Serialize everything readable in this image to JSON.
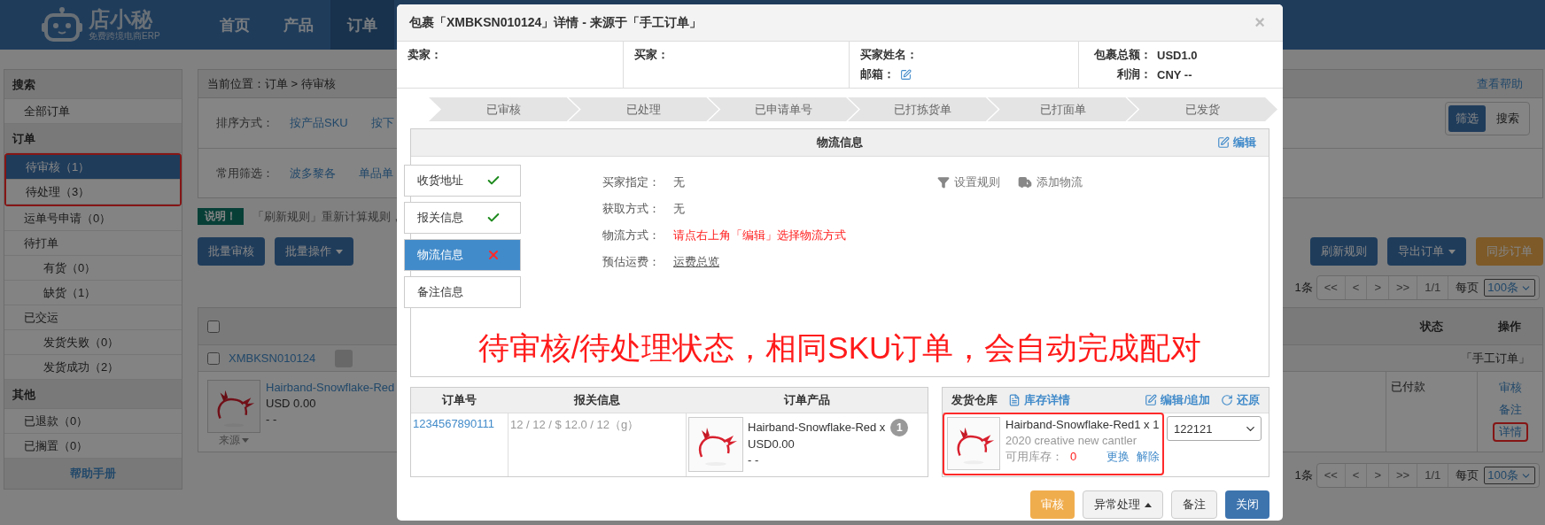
{
  "header": {
    "logo_name": "店小秘",
    "logo_tagline": "免费跨境电商ERP",
    "nav": [
      {
        "label": "首页",
        "selected": false
      },
      {
        "label": "产品",
        "selected": false
      },
      {
        "label": "订单",
        "selected": true
      }
    ]
  },
  "sidebar": {
    "sections": [
      {
        "title": "搜索",
        "items": [
          {
            "label": "全部订单",
            "selected": false,
            "highlighted": false
          }
        ]
      },
      {
        "title": "订单",
        "items": [
          {
            "label": "待审核（1）",
            "selected": true,
            "highlighted": true
          },
          {
            "label": "待处理（3）",
            "selected": false,
            "highlighted": true
          },
          {
            "label": "运单号申请（0）",
            "selected": false,
            "highlighted": false
          },
          {
            "label": "待打单",
            "selected": false,
            "highlighted": false,
            "children": [
              {
                "label": "有货（0）",
                "selected": false
              },
              {
                "label": "缺货（1）",
                "selected": false
              }
            ]
          },
          {
            "label": "已交运",
            "selected": false,
            "highlighted": false,
            "children": [
              {
                "label": "发货失败（0）",
                "selected": false
              },
              {
                "label": "发货成功（2）",
                "selected": false
              }
            ]
          }
        ]
      },
      {
        "title": "其他",
        "items": [
          {
            "label": "已退款（0）",
            "selected": false,
            "highlighted": false
          },
          {
            "label": "已搁置（0）",
            "selected": false,
            "highlighted": false
          }
        ]
      }
    ],
    "help": "帮助手册"
  },
  "main": {
    "breadcrumb": {
      "label": "当前位置：",
      "path": "订单 > 待审核"
    },
    "help_link": "查看帮助",
    "filters": [
      {
        "label": "排序方式：",
        "options": [
          "按产品SKU",
          "按下"
        ]
      },
      {
        "label": "常用筛选：",
        "options": [
          "波多黎各",
          "单品单"
        ]
      }
    ],
    "mode_toggle": [
      {
        "label": "筛选",
        "selected": true
      },
      {
        "label": "搜索",
        "selected": false
      }
    ],
    "notice": {
      "badge": "说明！",
      "text": "「刷新规则」重新计算规则，"
    },
    "left_buttons": [
      {
        "label": "批量审核",
        "dropdown": false
      },
      {
        "label": "批量操作",
        "dropdown": true
      }
    ],
    "right_buttons": [
      {
        "label": "刷新规则",
        "kind": "primary",
        "dropdown": false
      },
      {
        "label": "导出订单",
        "kind": "primary",
        "dropdown": true
      },
      {
        "label": "同步订单",
        "kind": "warning",
        "dropdown": false
      }
    ],
    "paginations": [
      {
        "total": "1条",
        "pages": [
          "<<",
          "<",
          ">",
          ">>",
          "1/1"
        ],
        "per_page_label": "每页",
        "per_page": "100条"
      },
      {
        "total": "1条",
        "pages": [
          "<<",
          "<",
          ">",
          ">>",
          "1/1"
        ],
        "per_page_label": "每页",
        "per_page": "100条"
      }
    ],
    "table": {
      "checked": false,
      "columns": [
        "状态",
        "操作"
      ],
      "orders": [
        {
          "checked": false,
          "package_no": "XMBKSN010124",
          "source": "「手工订单」",
          "product": {
            "name": "Hairband-Snowflake-Red",
            "price": "USD 0.00",
            "extra": "- -"
          },
          "source_toggle": "来源",
          "status": "已付款",
          "actions": [
            {
              "label": "审核",
              "highlighted": false
            },
            {
              "label": "备注",
              "highlighted": false
            },
            {
              "label": "详情",
              "highlighted": true
            }
          ]
        }
      ]
    }
  },
  "modal": {
    "title": "包裹「XMBKSN010124」详情 - 来源于「手工订单」",
    "close": "×",
    "info_columns": [
      [
        {
          "label": "卖家：",
          "kind": "text"
        }
      ],
      [
        {
          "label": "买家：",
          "kind": "text"
        }
      ],
      [
        {
          "label": "买家姓名：",
          "kind": "text"
        },
        {
          "label": "邮箱：",
          "kind": "edit"
        }
      ],
      [
        {
          "label": "包裹总额：",
          "value": "USD1.0",
          "kind": "text"
        },
        {
          "label": "利润：",
          "value": "CNY --",
          "kind": "text"
        }
      ]
    ],
    "steps": [
      "已审核",
      "已处理",
      "已申请单号",
      "已打拣货单",
      "已打面单",
      "已发货"
    ],
    "logistics": {
      "title": "物流信息",
      "edit": "编辑",
      "tabs": [
        {
          "label": "收货地址",
          "kind": "ok",
          "selected": false
        },
        {
          "label": "报关信息",
          "kind": "ok",
          "selected": false
        },
        {
          "label": "物流信息",
          "kind": "error",
          "selected": true
        },
        {
          "label": "备注信息",
          "kind": "plain",
          "selected": false
        }
      ],
      "fields": [
        {
          "label": "买家指定：",
          "value": "无",
          "kind": "text"
        },
        {
          "label": "获取方式：",
          "value": "无",
          "kind": "text"
        },
        {
          "label": "物流方式：",
          "value": "请点右上角「编辑」选择物流方式",
          "kind": "error"
        },
        {
          "label": "预估运费：",
          "value": "运费总览",
          "kind": "link"
        }
      ],
      "tools": [
        {
          "label": "设置规则",
          "kind": "filter"
        },
        {
          "label": "添加物流",
          "kind": "truck"
        }
      ],
      "annotation": "待审核/待处理状态，相同SKU订单，会自动完成配对"
    },
    "order_table": {
      "columns": [
        "订单号",
        "报关信息",
        "订单产品"
      ],
      "rows": [
        {
          "order_no": "1234567890111",
          "customs": "12 / 12 / $ 12.0 / 12（g）",
          "product": {
            "name": "Hairband-Snowflake-Red x",
            "qty": "1",
            "price": "USD0.00",
            "extra": "- -"
          }
        }
      ]
    },
    "warehouse": {
      "title": "发货仓库",
      "stock_link": "库存详情",
      "edit": "编辑/追加",
      "restore": "还原",
      "items": [
        {
          "name": "Hairband-Snowflake-Red1 x 1",
          "desc": "2020 creative new cantler",
          "stock_label": "可用库存：",
          "stock": "0",
          "actions": [
            "更换",
            "解除"
          ],
          "highlighted": true,
          "warehouse": "122121"
        }
      ]
    },
    "footer_buttons": [
      {
        "label": "审核",
        "kind": "warning",
        "dropup": false
      },
      {
        "label": "异常处理",
        "kind": "default",
        "dropup": true
      },
      {
        "label": "备注",
        "kind": "default",
        "dropup": false
      },
      {
        "label": "关闭",
        "kind": "primary",
        "dropup": false
      }
    ]
  }
}
